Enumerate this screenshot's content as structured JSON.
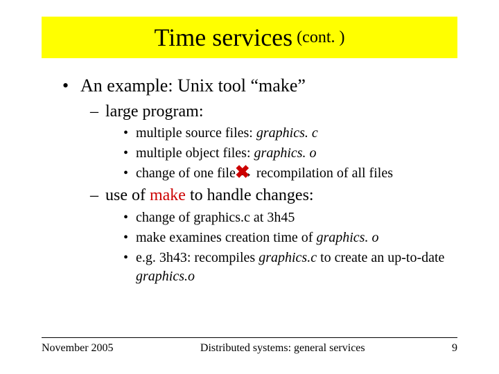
{
  "title": {
    "main": "Time services",
    "suffix": " (cont. )"
  },
  "bullets": {
    "l1a": "An example: Unix tool “make”",
    "l2a": "large program:",
    "l3a_pre": "multiple source files: ",
    "l3a_em": "graphics. c",
    "l3b_pre": "multiple object files: ",
    "l3b_em": "graphics. o",
    "l3c_pre": "change of one file ",
    "l3c_arrow": "→",
    "l3c_post": " recompilation of all files",
    "l2b_pre": " use of ",
    "l2b_red": "make",
    "l2b_post": " to handle changes:",
    "l3d": "change of graphics.c at 3h45",
    "l3e_pre": "make examines creation time of ",
    "l3e_em": "graphics. o",
    "l3f_pre": "e.g. 3h43: recompiles ",
    "l3f_em1": "graphics.c",
    "l3f_mid": " to create an up-to-date ",
    "l3f_em2": "graphics.o"
  },
  "footer": {
    "left": "November 2005",
    "center": "Distributed systems: general services",
    "right": "9"
  },
  "markers": {
    "dot": "•",
    "dash": "–"
  },
  "cross_glyph": "✖"
}
